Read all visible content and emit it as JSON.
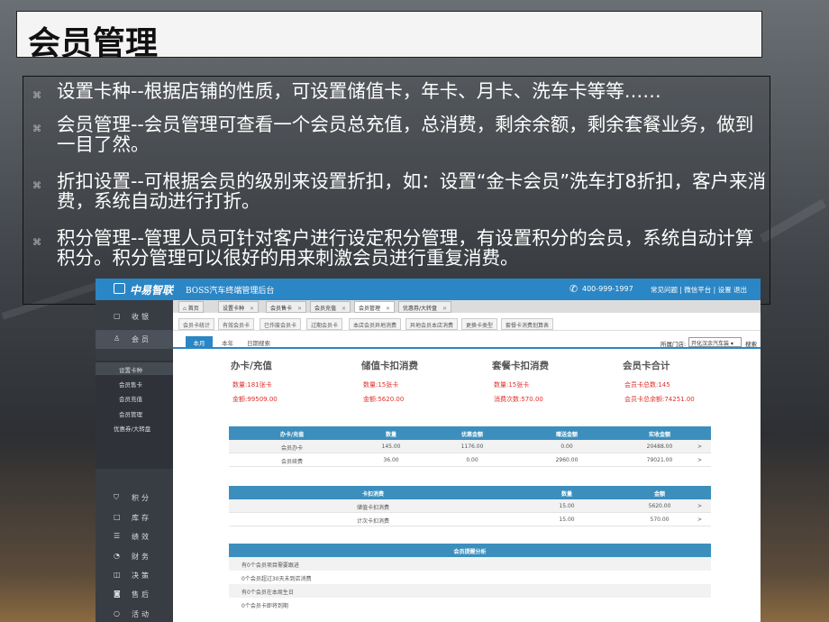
{
  "slide": {
    "title": "会员管理",
    "bullets": [
      {
        "mark": "⌘",
        "text": "设置卡种--根据店铺的性质，可设置储值卡，年卡、月卡、洗车卡等等……"
      },
      {
        "mark": "⌘",
        "text": "会员管理--会员管理可查看一个会员总充值，总消费，剩余余额，剩余套餐业务，做到一目了然。"
      },
      {
        "mark": "⌘",
        "text": "折扣设置--可根据会员的级别来设置折扣，如：设置“金卡会员”洗车打8折扣，客户来消费，系统自动进行打折。"
      },
      {
        "mark": "⌘",
        "text": "积分管理--管理人员可针对客户进行设定积分管理，有设置积分的会员，系统自动计算积分。积分管理可以很好的用来刺激会员进行重复消费。"
      }
    ]
  },
  "app": {
    "logo": "中易智联",
    "subtitle": "BOSS汽车终端管理后台",
    "phone_icon": "✆",
    "phone": "400-999-1997",
    "links": "常见问题 | 微信平台 | 设置   退出",
    "sidebar": [
      {
        "icon": "▢",
        "label": "收银"
      },
      {
        "icon": "♙",
        "label": "会员"
      },
      {
        "icon": "⛉",
        "label": "积分"
      },
      {
        "icon": "□",
        "label": "库存"
      },
      {
        "icon": "☰",
        "label": "绩效"
      },
      {
        "icon": "◔",
        "label": "财务"
      },
      {
        "icon": "◫",
        "label": "决策"
      },
      {
        "icon": "◙",
        "label": "售后"
      },
      {
        "icon": "○",
        "label": "活动"
      }
    ],
    "sidebar_sub": [
      "设置卡种",
      "会员售卡",
      "会员充值",
      "会员管理",
      "优惠券/大转盘"
    ],
    "tabs1": [
      "首页",
      "设置卡种",
      "会员售卡",
      "会员充值",
      "会员管理",
      "优惠券/大转盘"
    ],
    "tabs2": [
      "会员卡统计",
      "有效会员卡",
      "已作废会员卡",
      "过期会员卡",
      "本店会员异地消费",
      "异地会员本店消费",
      "更换卡类型",
      "套餐卡消费划算表"
    ],
    "tabs3": [
      "本月",
      "本年",
      "日期搜索"
    ],
    "store_label": "所属门店:",
    "store_value": "开化汉余汽车装 ▾",
    "store_btn": "搜索",
    "stats": [
      {
        "title": "办卡/充值",
        "a": "数量:181张卡",
        "b": "金额:99509.00"
      },
      {
        "title": "储值卡扣消费",
        "a": "数量:15张卡",
        "b": "金额:5620.00"
      },
      {
        "title": "套餐卡扣消费",
        "a": "数量:15张卡",
        "b": "消费次数:570.00"
      },
      {
        "title": "会员卡合计",
        "a": "会员卡总数:145",
        "b": "会员卡总余额:74251.00"
      }
    ],
    "table1": {
      "headers": [
        "办卡/充值",
        "数量",
        "优惠金额",
        "赠送金额",
        "实收金额"
      ],
      "rows": [
        [
          "会员办卡",
          "145.00",
          "1176.00",
          "0.00",
          "20488.00",
          ">"
        ],
        [
          "会员续费",
          "36.00",
          "0.00",
          "2960.00",
          "79021.00",
          ">"
        ]
      ]
    },
    "table2": {
      "headers": [
        "卡扣消费",
        "数量",
        "金额"
      ],
      "rows": [
        [
          "储值卡扣消费",
          "15.00",
          "5620.00",
          ">"
        ],
        [
          "计次卡扣消费",
          "15.00",
          "570.00",
          ">"
        ]
      ]
    },
    "table3": {
      "header": "会员提醒分析",
      "rows": [
        "有0个会员项目需要跟进",
        "0个会员超过30天未到店消费",
        "有0个会员在本周生日",
        "0个会员卡即将到期"
      ]
    }
  }
}
